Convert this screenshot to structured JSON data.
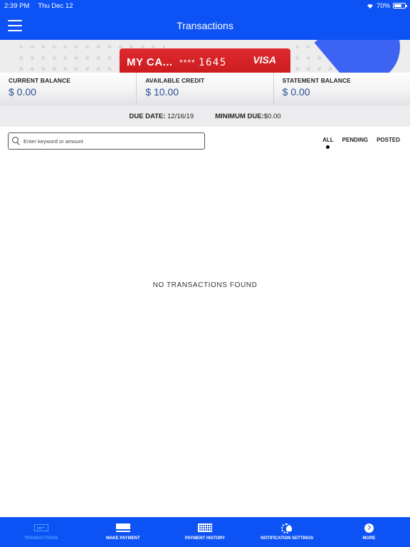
{
  "status": {
    "time": "2:39 PM",
    "date": "Thu Dec 12",
    "battery": "70%",
    "battery_level": 0.7
  },
  "header": {
    "title": "Transactions"
  },
  "card": {
    "name": "MY CA...",
    "masked": "****",
    "last4": "1645",
    "brand": "VISA"
  },
  "balances": [
    {
      "label": "CURRENT BALANCE",
      "value": "$ 0.00"
    },
    {
      "label": "AVAILABLE CREDIT",
      "value": "$ 10.00"
    },
    {
      "label": "STATEMENT BALANCE",
      "value": "$ 0.00"
    }
  ],
  "due": {
    "due_label": "DUE DATE:",
    "due_value": "12/16/19",
    "min_label": "MINIMUM DUE:",
    "min_value": "$0.00"
  },
  "search": {
    "placeholder": "Enter keyword or amount",
    "value": ""
  },
  "filters": [
    {
      "label": "ALL",
      "selected": true
    },
    {
      "label": "PENDING",
      "selected": false
    },
    {
      "label": "POSTED",
      "selected": false
    }
  ],
  "empty_message": "NO TRANSACTIONS FOUND",
  "tabs": [
    {
      "label": "TRANSACTIONS",
      "icon": "transactions-icon",
      "active": true
    },
    {
      "label": "MAKE PAYMENT",
      "icon": "card-payment-icon",
      "active": false
    },
    {
      "label": "PAYMENT HISTORY",
      "icon": "calendar-icon",
      "active": false
    },
    {
      "label": "NOTIFICATION SETTINGS",
      "icon": "notification-gear-icon",
      "active": false
    },
    {
      "label": "MORE",
      "icon": "chevron-right-circle-icon",
      "active": false
    }
  ],
  "colors": {
    "brand": "#0d52f5",
    "card": "#d7202a",
    "active_tab": "#4ea2ff",
    "balance_value": "#2a4c8f"
  }
}
